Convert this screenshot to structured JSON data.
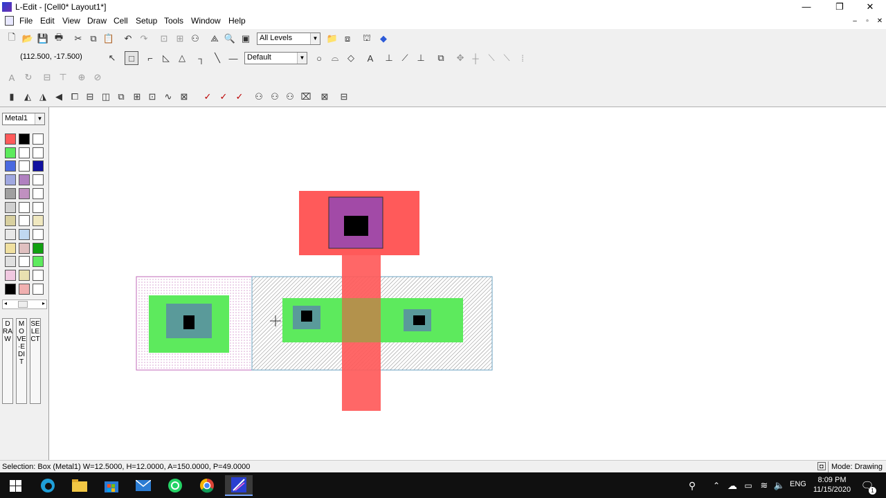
{
  "window": {
    "title": "L-Edit - [Cell0*     Layout1*]",
    "minimize": "—",
    "restore": "❐",
    "close": "✕"
  },
  "menu": [
    "File",
    "Edit",
    "View",
    "Draw",
    "Cell",
    "Setup",
    "Tools",
    "Window",
    "Help"
  ],
  "mdi": {
    "minimize": "–",
    "restore": "▫",
    "close": "✕"
  },
  "toolbar1": {
    "levels_value": "All Levels"
  },
  "toolbar2": {
    "coords": "(112.500, -17.500)",
    "wire_style": "Default"
  },
  "palette": {
    "layer_value": "Metal1",
    "modes": {
      "draw": "DRAW",
      "move_edit": "MOVE·EDIT",
      "select": "SELECT"
    }
  },
  "status": {
    "selection": "Selection: Box (Metal1) W=12.5000, H=12.0000, A=150.0000, P=49.0000",
    "mode": "Mode: Drawing"
  },
  "taskbar": {
    "time": "8:09 PM",
    "date": "11/15/2020",
    "lang": "ENG",
    "notif_count": "1"
  },
  "colors": {
    "poly": "#ff5a5a",
    "metal1": "#a24aa7",
    "active": "#5dea5d",
    "contact": "#000000",
    "diff_tint": "#5a9a9a"
  }
}
